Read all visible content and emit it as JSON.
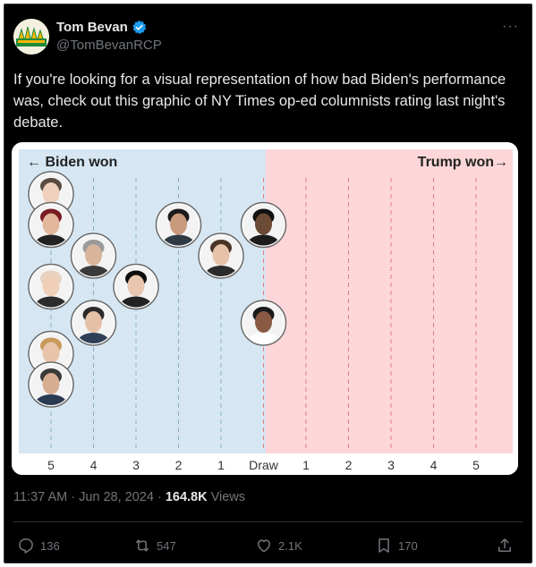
{
  "author": {
    "name": "Tom Bevan",
    "handle": "@TomBevanRCP",
    "verified": true
  },
  "tweet": {
    "text": "If you're looking for a visual representation of how bad Biden's performance was, check out this graphic of NY Times op-ed columnists rating last night's debate.",
    "time": "11:37 AM · Jun 28, 2024 · ",
    "views_count": "164.8K",
    "views_label": " Views"
  },
  "actions": {
    "replies": "136",
    "reposts": "547",
    "likes": "2.1K",
    "bookmarks": "170"
  },
  "graphic": {
    "left_label": "← Biden won",
    "right_label": "Trump won→",
    "colors": {
      "biden": "#d6e7f3",
      "trump": "#fcd6d8",
      "biden_line": "#7fb0d0",
      "trump_line": "#e08087"
    },
    "axis_ticks": [
      "5",
      "4",
      "3",
      "2",
      "1",
      "Draw",
      "1",
      "2",
      "3",
      "4",
      "5"
    ]
  },
  "chart_data": {
    "type": "scatter",
    "title": "",
    "xlabel": "",
    "categories": [
      "5",
      "4",
      "3",
      "2",
      "1",
      "Draw",
      "1",
      "2",
      "3",
      "4",
      "5"
    ],
    "columnists": [
      {
        "x": "Draw",
        "row": 1
      },
      {
        "x": "Draw",
        "row": 4
      },
      {
        "x": "1",
        "row": 2
      },
      {
        "x": "2",
        "row": 1
      },
      {
        "x": "3",
        "row": 3
      },
      {
        "x": "4",
        "row": 2
      },
      {
        "x": "4",
        "row": 4
      },
      {
        "x": "5",
        "row": 0
      },
      {
        "x": "5",
        "row": 1
      },
      {
        "x": "5",
        "row": 3
      },
      {
        "x": "5",
        "row": 5
      },
      {
        "x": "5",
        "row": 6
      }
    ]
  }
}
